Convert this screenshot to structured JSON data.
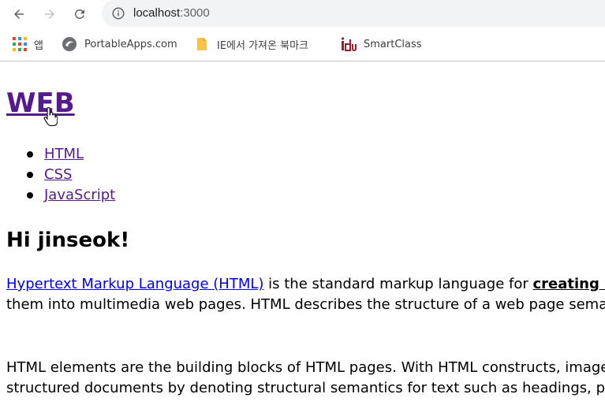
{
  "browser": {
    "url_host": "localhost",
    "url_port": ":3000",
    "bookmarks": {
      "apps_label": "앱",
      "portableapps_label": "PortableApps.com",
      "ie_label": "IE에서 가져온 북마크",
      "smartclass_label": "SmartClass"
    }
  },
  "page": {
    "title": "WEB",
    "nav": [
      "HTML",
      "CSS",
      "JavaScript"
    ],
    "greeting": "Hi jinseok!",
    "para1": {
      "link": "Hypertext Markup Language (HTML)",
      "text_a": " is the standard markup language for ",
      "bold": "creating web pages",
      "line2": "them into multimedia web pages. HTML describes the structure of a web page semantically"
    },
    "para2": {
      "line1": "HTML elements are the building blocks of HTML pages. With HTML constructs, images and other",
      "line2": "structured documents by denoting structural semantics for text such as headings, paragraphs,"
    }
  },
  "colors": {
    "visited_link": "#551a8b",
    "link": "#0000ee",
    "omnibox_bg": "#f1f3f4"
  },
  "icons": [
    "back-arrow-icon",
    "forward-arrow-icon",
    "reload-icon",
    "info-icon",
    "apps-grid-icon",
    "portableapps-icon",
    "folder-icon",
    "smartclass-icon",
    "hand-cursor-icon"
  ]
}
